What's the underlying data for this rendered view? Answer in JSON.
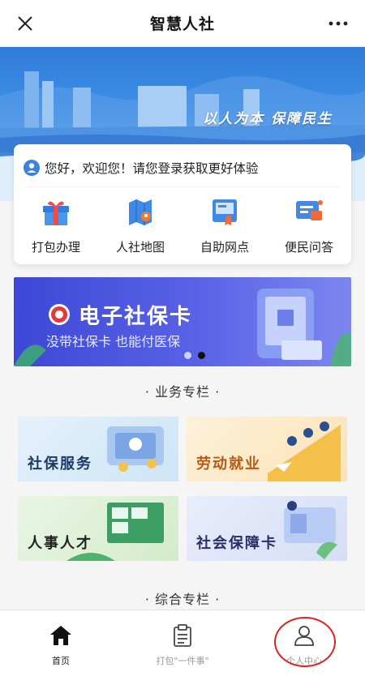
{
  "navbar": {
    "title": "智慧人社"
  },
  "hero": {
    "slogan": "以人为本  保障民生"
  },
  "welcome": {
    "text": "您好，欢迎您！请您登录获取更好体验"
  },
  "quick_links": [
    {
      "label": "打包办理",
      "icon": "gift-icon"
    },
    {
      "label": "人社地图",
      "icon": "map-icon"
    },
    {
      "label": "自助网点",
      "icon": "kiosk-icon"
    },
    {
      "label": "便民问答",
      "icon": "chat-icon"
    }
  ],
  "ecard_banner": {
    "title": "电子社保卡",
    "subtitle": "没带社保卡 也能付医保"
  },
  "sections": {
    "business": "· 业务专栏 ·",
    "integrated": "· 综合专栏 ·"
  },
  "tiles": [
    {
      "label": "社保服务",
      "bg_from": "#e4f1fb",
      "bg_to": "#cde5f6",
      "color": "#1d3a63"
    },
    {
      "label": "劳动就业",
      "bg_from": "#fdf1db",
      "bg_to": "#fbe2b5",
      "color": "#b45a12"
    },
    {
      "label": "人事人才",
      "bg_from": "#eaf5e5",
      "bg_to": "#d3ecc8",
      "color": "#222222"
    },
    {
      "label": "社会保障卡",
      "bg_from": "#e8edfb",
      "bg_to": "#d6def5",
      "color": "#2a2f6b"
    }
  ],
  "tabbar": [
    {
      "label": "首页",
      "icon": "home-icon",
      "active": true
    },
    {
      "label": "打包\"一件事\"",
      "icon": "clipboard-icon",
      "active": false
    },
    {
      "label": "个人中心",
      "icon": "user-icon",
      "active": false
    }
  ],
  "colors": {
    "accent": "#3a84e0",
    "banner_blue": "#3c47d6",
    "highlight_red": "#e02020"
  }
}
